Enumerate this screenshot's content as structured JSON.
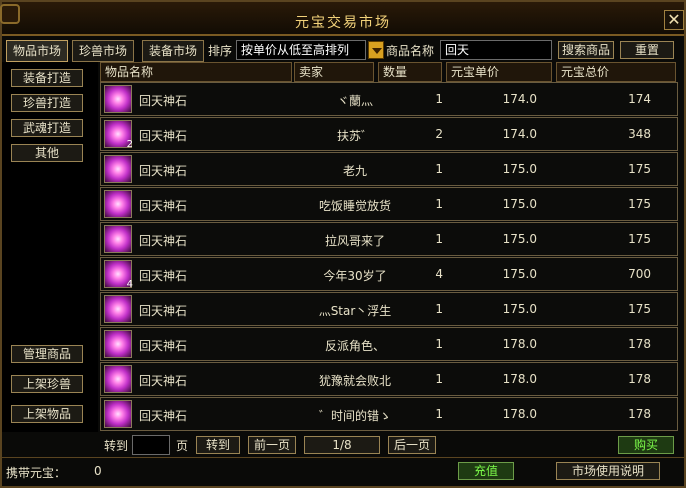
{
  "window": {
    "title": "元宝交易市场",
    "close_label": "✕"
  },
  "tabs": [
    "物品市场",
    "珍兽市场",
    "装备市场"
  ],
  "active_tab": 0,
  "filter": {
    "sort_label": "排序",
    "sort_value": "按单价从低至高排列",
    "name_label": "商品名称",
    "name_value": "回天",
    "search_label": "搜索商品",
    "reset_label": "重置"
  },
  "sidebar": {
    "top": [
      "装备打造",
      "珍兽打造",
      "武魂打造",
      "其他"
    ],
    "bottom": [
      "管理商品",
      "上架珍兽",
      "上架物品"
    ]
  },
  "columns": [
    "物品名称",
    "卖家",
    "数量",
    "元宝单价",
    "元宝总价"
  ],
  "rows": [
    {
      "name": "回天神石",
      "seller": "ヾ蘭灬",
      "qty": "1",
      "unit": "174.0",
      "total": "174",
      "stack": ""
    },
    {
      "name": "回天神石",
      "seller": "扶苏゛",
      "qty": "2",
      "unit": "174.0",
      "total": "348",
      "stack": "2"
    },
    {
      "name": "回天神石",
      "seller": "老九",
      "qty": "1",
      "unit": "175.0",
      "total": "175",
      "stack": ""
    },
    {
      "name": "回天神石",
      "seller": "吃饭睡觉放货",
      "qty": "1",
      "unit": "175.0",
      "total": "175",
      "stack": ""
    },
    {
      "name": "回天神石",
      "seller": "拉风哥来了",
      "qty": "1",
      "unit": "175.0",
      "total": "175",
      "stack": ""
    },
    {
      "name": "回天神石",
      "seller": "今年30岁了",
      "qty": "4",
      "unit": "175.0",
      "total": "700",
      "stack": "4"
    },
    {
      "name": "回天神石",
      "seller": "灬Star丶浮生",
      "qty": "1",
      "unit": "175.0",
      "total": "175",
      "stack": ""
    },
    {
      "name": "回天神石",
      "seller": "反派角色、",
      "qty": "1",
      "unit": "178.0",
      "total": "178",
      "stack": ""
    },
    {
      "name": "回天神石",
      "seller": "犹豫就会败北",
      "qty": "1",
      "unit": "178.0",
      "total": "178",
      "stack": ""
    },
    {
      "name": "回天神石",
      "seller": "゛时间的错ゝ",
      "qty": "1",
      "unit": "178.0",
      "total": "178",
      "stack": ""
    }
  ],
  "paging": {
    "goto_label": "转到",
    "page_unit": "页",
    "goto_button": "转到",
    "prev_label": "前一页",
    "page_indicator": "1/8",
    "next_label": "后一页",
    "buy_label": "购买"
  },
  "footer": {
    "balance_label": "携带元宝：",
    "balance_value": "0",
    "recharge_label": "充值",
    "help_label": "市场使用说明"
  }
}
